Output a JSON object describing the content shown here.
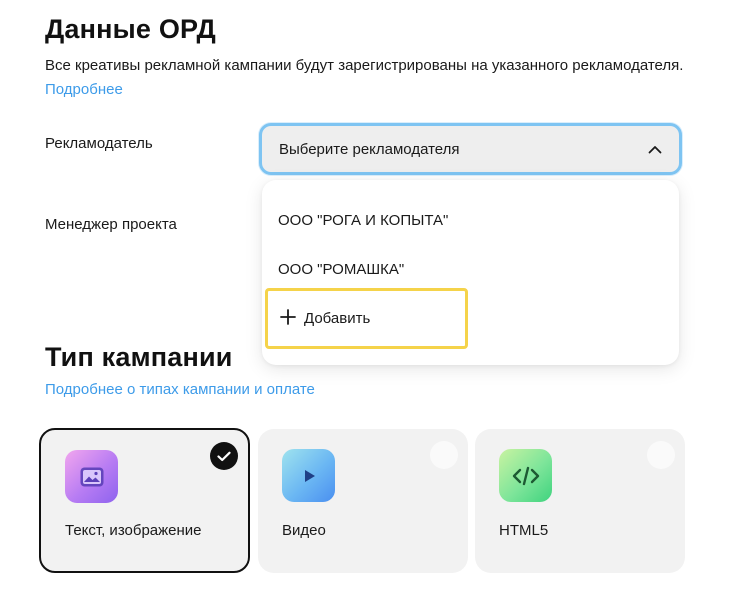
{
  "ord": {
    "title": "Данные ОРД",
    "description": "Все креативы рекламной кампании будут зарегистрированы на указанного рекламодателя.",
    "more_link": "Подробнее"
  },
  "form": {
    "advertiser_label": "Рекламодатель",
    "manager_label": "Менеджер проекта",
    "advertiser_placeholder": "Выберите рекламодателя"
  },
  "dropdown": {
    "options": [
      "ООО \"РОГА И КОПЫТА\"",
      "ООО \"РОМАШКА\""
    ],
    "add_label": "Добавить"
  },
  "campaign": {
    "title": "Тип кампании",
    "link": "Подробнее о типах кампании и оплате",
    "types": [
      {
        "label": "Текст, изображение",
        "selected": true,
        "icon": "image-icon"
      },
      {
        "label": "Видео",
        "selected": false,
        "icon": "video-play-icon"
      },
      {
        "label": "HTML5",
        "selected": false,
        "icon": "code-icon"
      }
    ]
  },
  "colors": {
    "accent_link": "#3d9be9",
    "select_focus_border": "#7ec4f2",
    "highlight_border": "#f5d34a"
  }
}
